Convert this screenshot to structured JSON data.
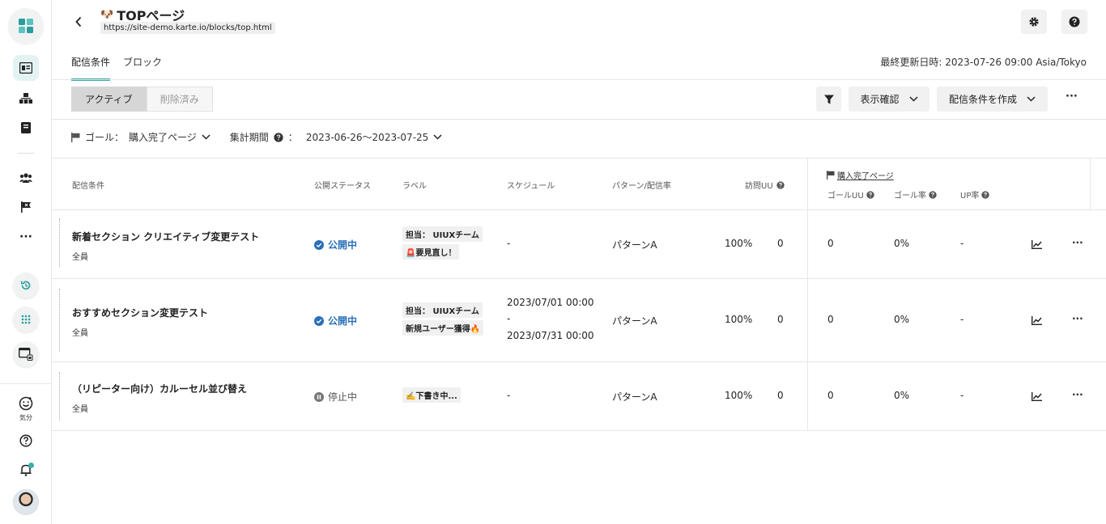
{
  "rail": {
    "mood_label": "気分"
  },
  "header": {
    "title_emoji": "🐶",
    "title": "TOPページ",
    "url": "https://site-demo.karte.io/blocks/top.html"
  },
  "tabs": [
    {
      "label": "配信条件",
      "active": true
    },
    {
      "label": "ブロック",
      "active": false
    }
  ],
  "updated_at": "最終更新日時: 2023-07-26 09:00 Asia/Tokyo",
  "toolbar": {
    "segments": [
      "アクティブ",
      "削除済み"
    ],
    "preview_label": "表示確認",
    "create_label": "配信条件を作成",
    "more": "···"
  },
  "filters": {
    "goal_label": "ゴール：",
    "goal_value": "購入完了ページ",
    "period_label": "集計期間",
    "period_colon": "：",
    "period_value": "2023-06-26〜2023-07-25"
  },
  "table": {
    "headers": {
      "condition": "配信条件",
      "status": "公開ステータス",
      "label": "ラベル",
      "schedule": "スケジュール",
      "pattern": "パターン/配信率",
      "visit_uu": "訪問UU",
      "goal_group": "購入完了ページ",
      "goal_uu": "ゴールUU",
      "goal_rate": "ゴール率",
      "up_rate": "UP率"
    },
    "rows": [
      {
        "name": "新着セクション クリエイティブ変更テスト",
        "segment": "全員",
        "status": "公開中",
        "labels": [
          "担当： UIUXチーム",
          "🚨要見直し！"
        ],
        "schedule": "-",
        "pattern": "パターンA",
        "rate": "100%",
        "visit_uu": "0",
        "goal_uu": "0",
        "goal_rate": "0%",
        "up_rate": "-"
      },
      {
        "name": "おすすめセクション変更テスト",
        "segment": "全員",
        "status": "公開中",
        "labels": [
          "担当： UIUXチーム",
          "新規ユーザー獲得🔥"
        ],
        "schedule_start": "2023/07/01 00:00",
        "schedule_dash": "-",
        "schedule_end": "2023/07/31 00:00",
        "pattern": "パターンA",
        "rate": "100%",
        "visit_uu": "0",
        "goal_uu": "0",
        "goal_rate": "0%",
        "up_rate": "-"
      },
      {
        "name": "（リピーター向け）カルーセル並び替え",
        "segment": "全員",
        "status": "停止中",
        "labels": [
          "✍️下書き中..."
        ],
        "schedule": "-",
        "pattern": "パターンA",
        "rate": "100%",
        "visit_uu": "0",
        "goal_uu": "0",
        "goal_rate": "0%",
        "up_rate": "-"
      }
    ]
  }
}
